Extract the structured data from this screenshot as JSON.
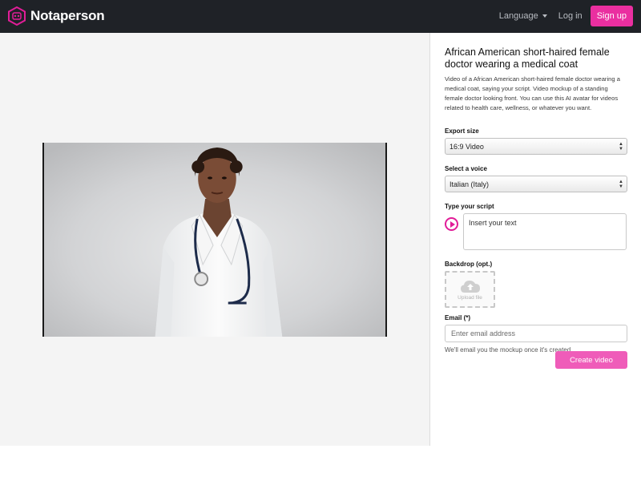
{
  "header": {
    "brand": "Notaperson",
    "language_label": "Language",
    "login_label": "Log in",
    "signup_label": "Sign up"
  },
  "preview": {
    "subject": "doctor-avatar"
  },
  "panel": {
    "title": "African American short-haired female doctor wearing a medical coat",
    "description": "Video of a African American short-haired female doctor wearing a medical coat, saying your script. Video mockup of a standing female doctor looking front. You can use this AI avatar for videos related to health care, wellness, or whatever you want.",
    "export_size": {
      "label": "Export size",
      "value": "16:9 Video"
    },
    "voice": {
      "label": "Select a voice",
      "value": "Italian (Italy)"
    },
    "script": {
      "label": "Type your script",
      "placeholder": "Insert your text"
    },
    "backdrop": {
      "label": "Backdrop (opt.)",
      "upload_text": "Upload file"
    },
    "email": {
      "label": "Email (*)",
      "placeholder": "Enter email address",
      "hint": "We'll email you the mockup once it's created"
    },
    "create_label": "Create video"
  },
  "colors": {
    "navbar": "#1f2227",
    "accent": "#ea2fa0",
    "button": "#ef5cb9"
  }
}
